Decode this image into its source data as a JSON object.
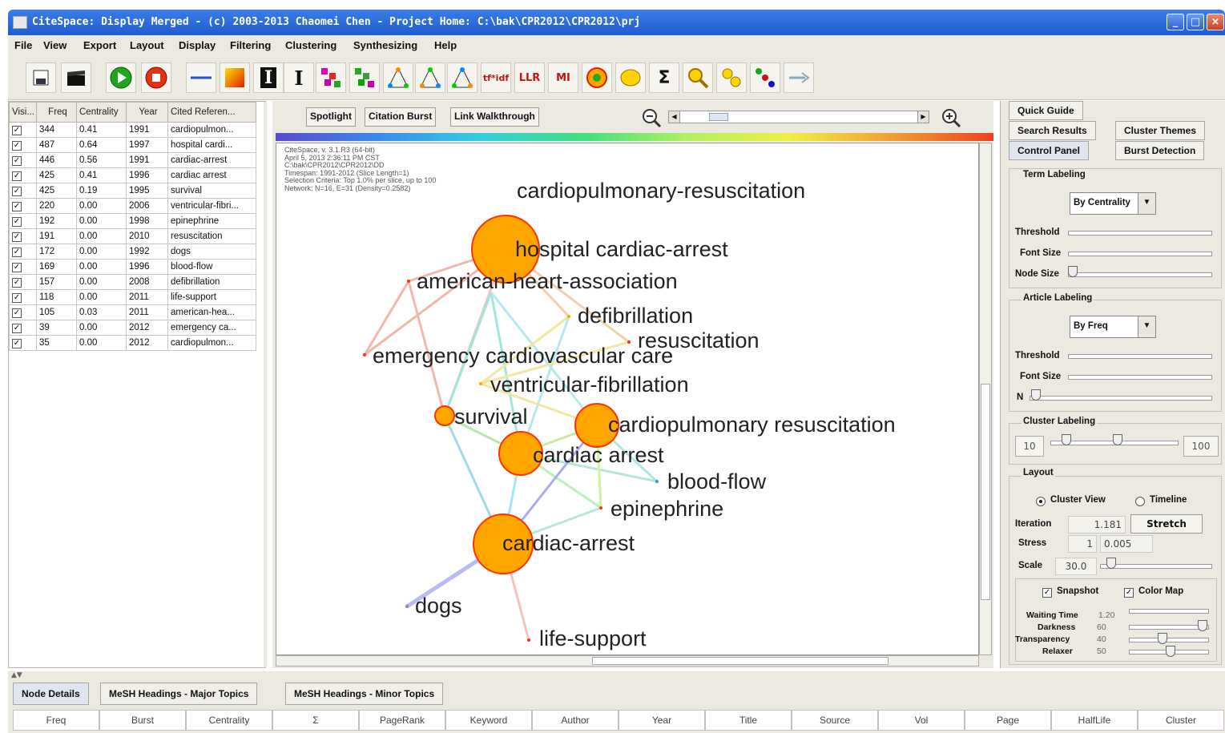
{
  "window": {
    "title": "CiteSpace: Display Merged - (c) 2003-2013 Chaomei Chen - Project Home: C:\\bak\\CPR2012\\CPR2012\\prj"
  },
  "menu": [
    "File",
    "View",
    "Export",
    "Layout",
    "Display",
    "Filtering",
    "Clustering",
    "Synthesizing",
    "Help"
  ],
  "toolbar": {
    "icons": [
      "save-icon",
      "clapper-icon",
      "play-icon",
      "stop-icon",
      "line-icon",
      "palette-icon",
      "bold-i-icon",
      "text-i-icon",
      "tree-icon",
      "tree2-icon",
      "triangle-icon",
      "triangle2-icon",
      "triangle3-icon",
      "tfidf-icon",
      "llr-icon",
      "mi-icon",
      "target-icon",
      "blob-icon",
      "sigma-icon",
      "search-icon",
      "link-icon",
      "dots-icon",
      "arrow-icon"
    ],
    "text_buttons": {
      "tfidf": "tf*idf",
      "llr": "LLR",
      "mi": "MI",
      "sigma": "Σ"
    }
  },
  "refs_table": {
    "headers": [
      "Visi...",
      "Freq",
      "Centrality",
      "Year",
      "Cited Referen..."
    ],
    "rows": [
      [
        "344",
        "0.41",
        "1991",
        "cardiopulmon..."
      ],
      [
        "487",
        "0.64",
        "1997",
        "hospital cardi..."
      ],
      [
        "446",
        "0.56",
        "1991",
        "cardiac-arrest"
      ],
      [
        "425",
        "0.41",
        "1996",
        "cardiac arrest"
      ],
      [
        "425",
        "0.19",
        "1995",
        "survival"
      ],
      [
        "220",
        "0.00",
        "2006",
        "ventricular-fibri..."
      ],
      [
        "192",
        "0.00",
        "1998",
        "epinephrine"
      ],
      [
        "191",
        "0.00",
        "2010",
        "resuscitation"
      ],
      [
        "172",
        "0.00",
        "1992",
        "dogs"
      ],
      [
        "169",
        "0.00",
        "1996",
        "blood-flow"
      ],
      [
        "157",
        "0.00",
        "2008",
        "defibrillation"
      ],
      [
        "118",
        "0.00",
        "2011",
        "life-support"
      ],
      [
        "105",
        "0.03",
        "2011",
        "american-hea..."
      ],
      [
        "39",
        "0.00",
        "2012",
        "emergency ca..."
      ],
      [
        "35",
        "0.00",
        "2012",
        "cardiopulmon..."
      ]
    ]
  },
  "center": {
    "buttons": [
      "Spotlight",
      "Citation Burst",
      "Link Walkthrough"
    ],
    "info": [
      "CiteSpace, v. 3.1.R3 (64-bit)",
      "April 5, 2013 2:36:11 PM CST",
      "C:\\bak\\CPR2012\\CPR2012\\DD",
      "Timespan: 1991-2012 (Slice Length=1)",
      "Selection Criteria: Top 1.0% per slice, up to 100",
      "Network: N=16, E=31 (Density=0.2582)"
    ],
    "nodes": [
      {
        "label": "cardiopulmonary-resuscitation"
      },
      {
        "label": "hospital cardiac-arrest"
      },
      {
        "label": "american-heart-association"
      },
      {
        "label": "defibrillation"
      },
      {
        "label": "resuscitation"
      },
      {
        "label": "emergency cardiovascular care"
      },
      {
        "label": "ventricular-fibrillation"
      },
      {
        "label": "survival"
      },
      {
        "label": "cardiopulmonary resuscitation"
      },
      {
        "label": "cardiac arrest"
      },
      {
        "label": "blood-flow"
      },
      {
        "label": "epinephrine"
      },
      {
        "label": "cardiac-arrest"
      },
      {
        "label": "dogs"
      },
      {
        "label": "life-support"
      }
    ]
  },
  "right": {
    "tabs": [
      "Quick Guide",
      "Search Results",
      "Cluster Themes",
      "Control Panel",
      "Burst Detection"
    ],
    "term_labeling": {
      "title": "Term Labeling",
      "select": "By Centrality",
      "threshold": "Threshold",
      "font_size": "Font Size",
      "node_size": "Node Size"
    },
    "article_labeling": {
      "title": "Article Labeling",
      "select": "By Freq",
      "threshold": "Threshold",
      "font_size": "Font Size",
      "n": "N"
    },
    "cluster_labeling": {
      "title": "Cluster Labeling",
      "min": "10",
      "max": "100"
    },
    "layout": {
      "title": "Layout",
      "cluster_view": "Cluster View",
      "timeline": "Timeline",
      "iteration": "Iteration",
      "iteration_val": "1.181",
      "stretch": "Stretch",
      "stress": "Stress",
      "stress_a": "1",
      "stress_b": "0.005",
      "scale": "Scale",
      "scale_val": "30.0",
      "snapshot": "Snapshot",
      "color_map": "Color Map",
      "waiting_time": "Waiting Time",
      "waiting_val": "1.20",
      "darkness": "Darkness",
      "darkness_val": "60",
      "transparency": "Transparency",
      "transparency_val": "40",
      "relaxer": "Relaxer",
      "relaxer_val": "50"
    }
  },
  "bottom": {
    "tabs": [
      "Node Details",
      "MeSH Headings - Major Topics",
      "MeSH Headings - Minor Topics"
    ],
    "columns": [
      "Freq",
      "Burst",
      "Centrality",
      "Σ",
      "PageRank",
      "Keyword",
      "Author",
      "Year",
      "Title",
      "Source",
      "Vol",
      "Page",
      "HalfLife",
      "Cluster"
    ]
  },
  "colors": {
    "title_bar": "#2a64d6",
    "node_fill": "#ffa500",
    "node_ring": "#ff3300"
  }
}
